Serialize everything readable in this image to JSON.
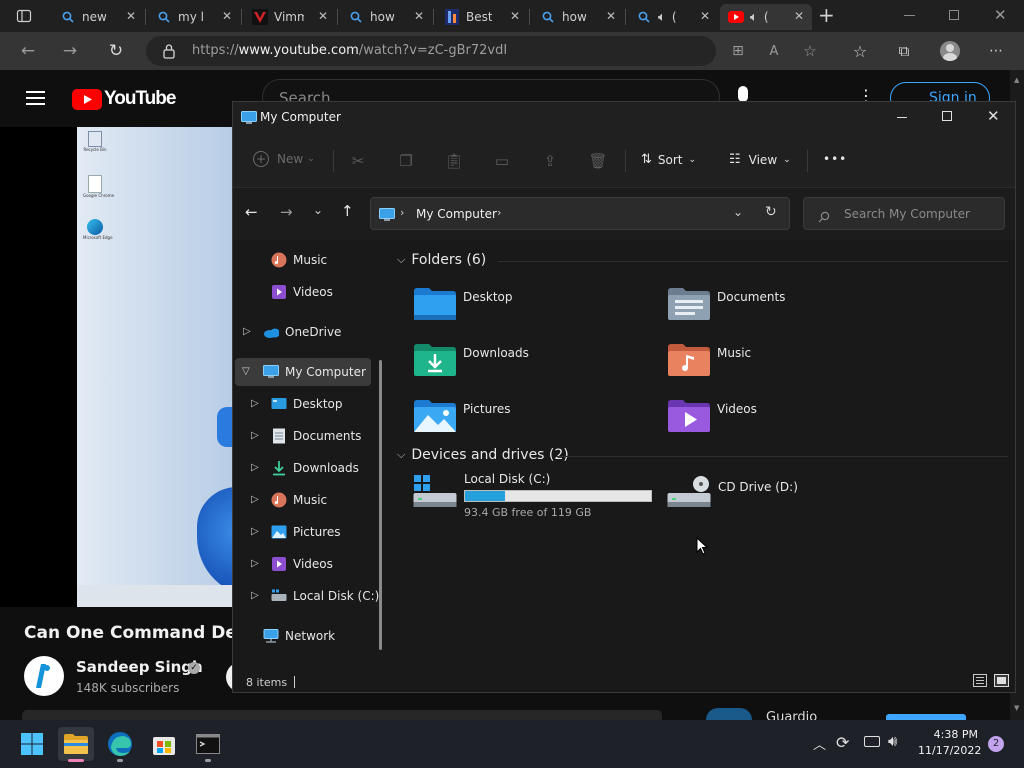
{
  "browser": {
    "tabs": [
      {
        "title": "new u",
        "icon": "search-icon"
      },
      {
        "title": "my lo",
        "icon": "search-icon"
      },
      {
        "title": "Vimm",
        "icon": "vimm-icon"
      },
      {
        "title": "how t",
        "icon": "search-icon"
      },
      {
        "title": "Best v",
        "icon": "image-icon"
      },
      {
        "title": "how t",
        "icon": "search-icon"
      },
      {
        "title": "(",
        "icon": "search-icon"
      },
      {
        "title": "(",
        "icon": "youtube-icon"
      }
    ],
    "new_tab_label": "+",
    "url_prefix": "https://",
    "url_host": "www.youtube.com",
    "url_path": "/watch?v=zC-gBr72vdI"
  },
  "youtube": {
    "logo_text": "YouTube",
    "search_placeholder": "Search",
    "sign_in_label": "Sign in",
    "video_title": "Can One Command Destr",
    "channel_name": "Sandeep Singh",
    "subscribers": "148K subscribers",
    "side_text": "Guardio",
    "desktop_icons": [
      "Recycle Bin",
      "Google Chrome",
      "Microsoft Edge"
    ]
  },
  "explorer": {
    "title": "My Computer",
    "toolbar": {
      "new_label": "New",
      "sort_label": "Sort",
      "view_label": "View",
      "more_label": "•••"
    },
    "breadcrumb": "My Computer",
    "search_placeholder": "Search My Computer",
    "nav": {
      "music": "Music",
      "videos": "Videos",
      "onedrive": "OneDrive",
      "my_computer": "My Computer",
      "children": [
        "Desktop",
        "Documents",
        "Downloads",
        "Music",
        "Pictures",
        "Videos",
        "Local Disk (C:)"
      ],
      "network": "Network"
    },
    "folders_header": "Folders (6)",
    "folders": [
      "Desktop",
      "Documents",
      "Downloads",
      "Music",
      "Pictures",
      "Videos"
    ],
    "drives_header": "Devices and drives (2)",
    "drives": [
      {
        "name": "Local Disk (C:)",
        "free": "93.4 GB free of 119 GB",
        "used_fraction": 0.215
      },
      {
        "name": "CD Drive (D:)"
      }
    ],
    "status": "8 items"
  },
  "taskbar": {
    "time": "4:38 PM",
    "date": "11/17/2022",
    "notification_count": "2"
  },
  "colors": {
    "accent": "#3a96dd",
    "youtube_red": "#ff0000",
    "folder_yellow": "#f4c14c"
  }
}
